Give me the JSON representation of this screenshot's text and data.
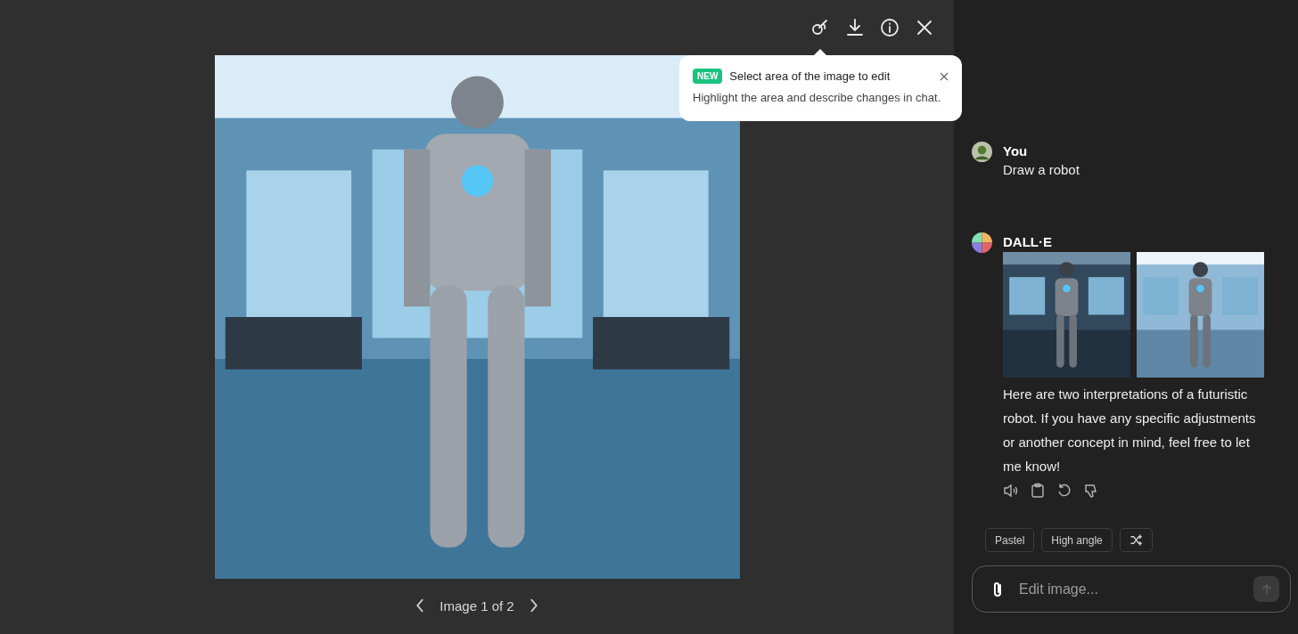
{
  "viewer": {
    "pager": "Image 1 of 2"
  },
  "tooltip": {
    "badge": "NEW",
    "title": "Select area of the image to edit",
    "body": "Highlight the area and describe changes in chat."
  },
  "messages": [
    {
      "kind": "user",
      "author": "You",
      "text": "Draw a robot"
    },
    {
      "kind": "assistant",
      "author": "DALL·E",
      "text": "Here are two interpretations of a futuristic robot. If you have any specific adjustments or another concept in mind, feel free to let me know!"
    }
  ],
  "suggestions": [
    "Pastel",
    "High angle"
  ],
  "composer": {
    "placeholder": "Edit image..."
  }
}
